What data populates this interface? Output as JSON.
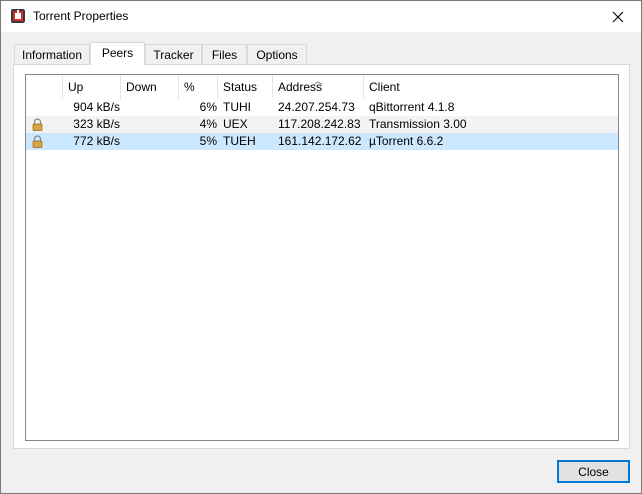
{
  "window": {
    "title": "Torrent Properties"
  },
  "tabs": [
    {
      "label": "Information"
    },
    {
      "label": "Peers"
    },
    {
      "label": "Tracker"
    },
    {
      "label": "Files"
    },
    {
      "label": "Options"
    }
  ],
  "active_tab": "Peers",
  "peers": {
    "columns": [
      "Up",
      "Down",
      "%",
      "Status",
      "Address",
      "Client"
    ],
    "sorted_column": "Address",
    "rows": [
      {
        "locked": false,
        "up": "904 kB/s",
        "down": "",
        "percent": "6%",
        "status": "TUHI",
        "address": "24.207.254.73",
        "client": "qBittorrent 4.1.8"
      },
      {
        "locked": true,
        "up": "323 kB/s",
        "down": "",
        "percent": "4%",
        "status": "UEX",
        "address": "117.208.242.83",
        "client": "Transmission 3.00"
      },
      {
        "locked": true,
        "up": "772 kB/s",
        "down": "",
        "percent": "5%",
        "status": "TUEH",
        "address": "161.142.172.62",
        "client": "µTorrent 6.6.2"
      }
    ],
    "selected_row": 2
  },
  "buttons": {
    "close_label": "Close"
  },
  "colors": {
    "selection": "#cce8ff",
    "accent": "#0078d7"
  }
}
